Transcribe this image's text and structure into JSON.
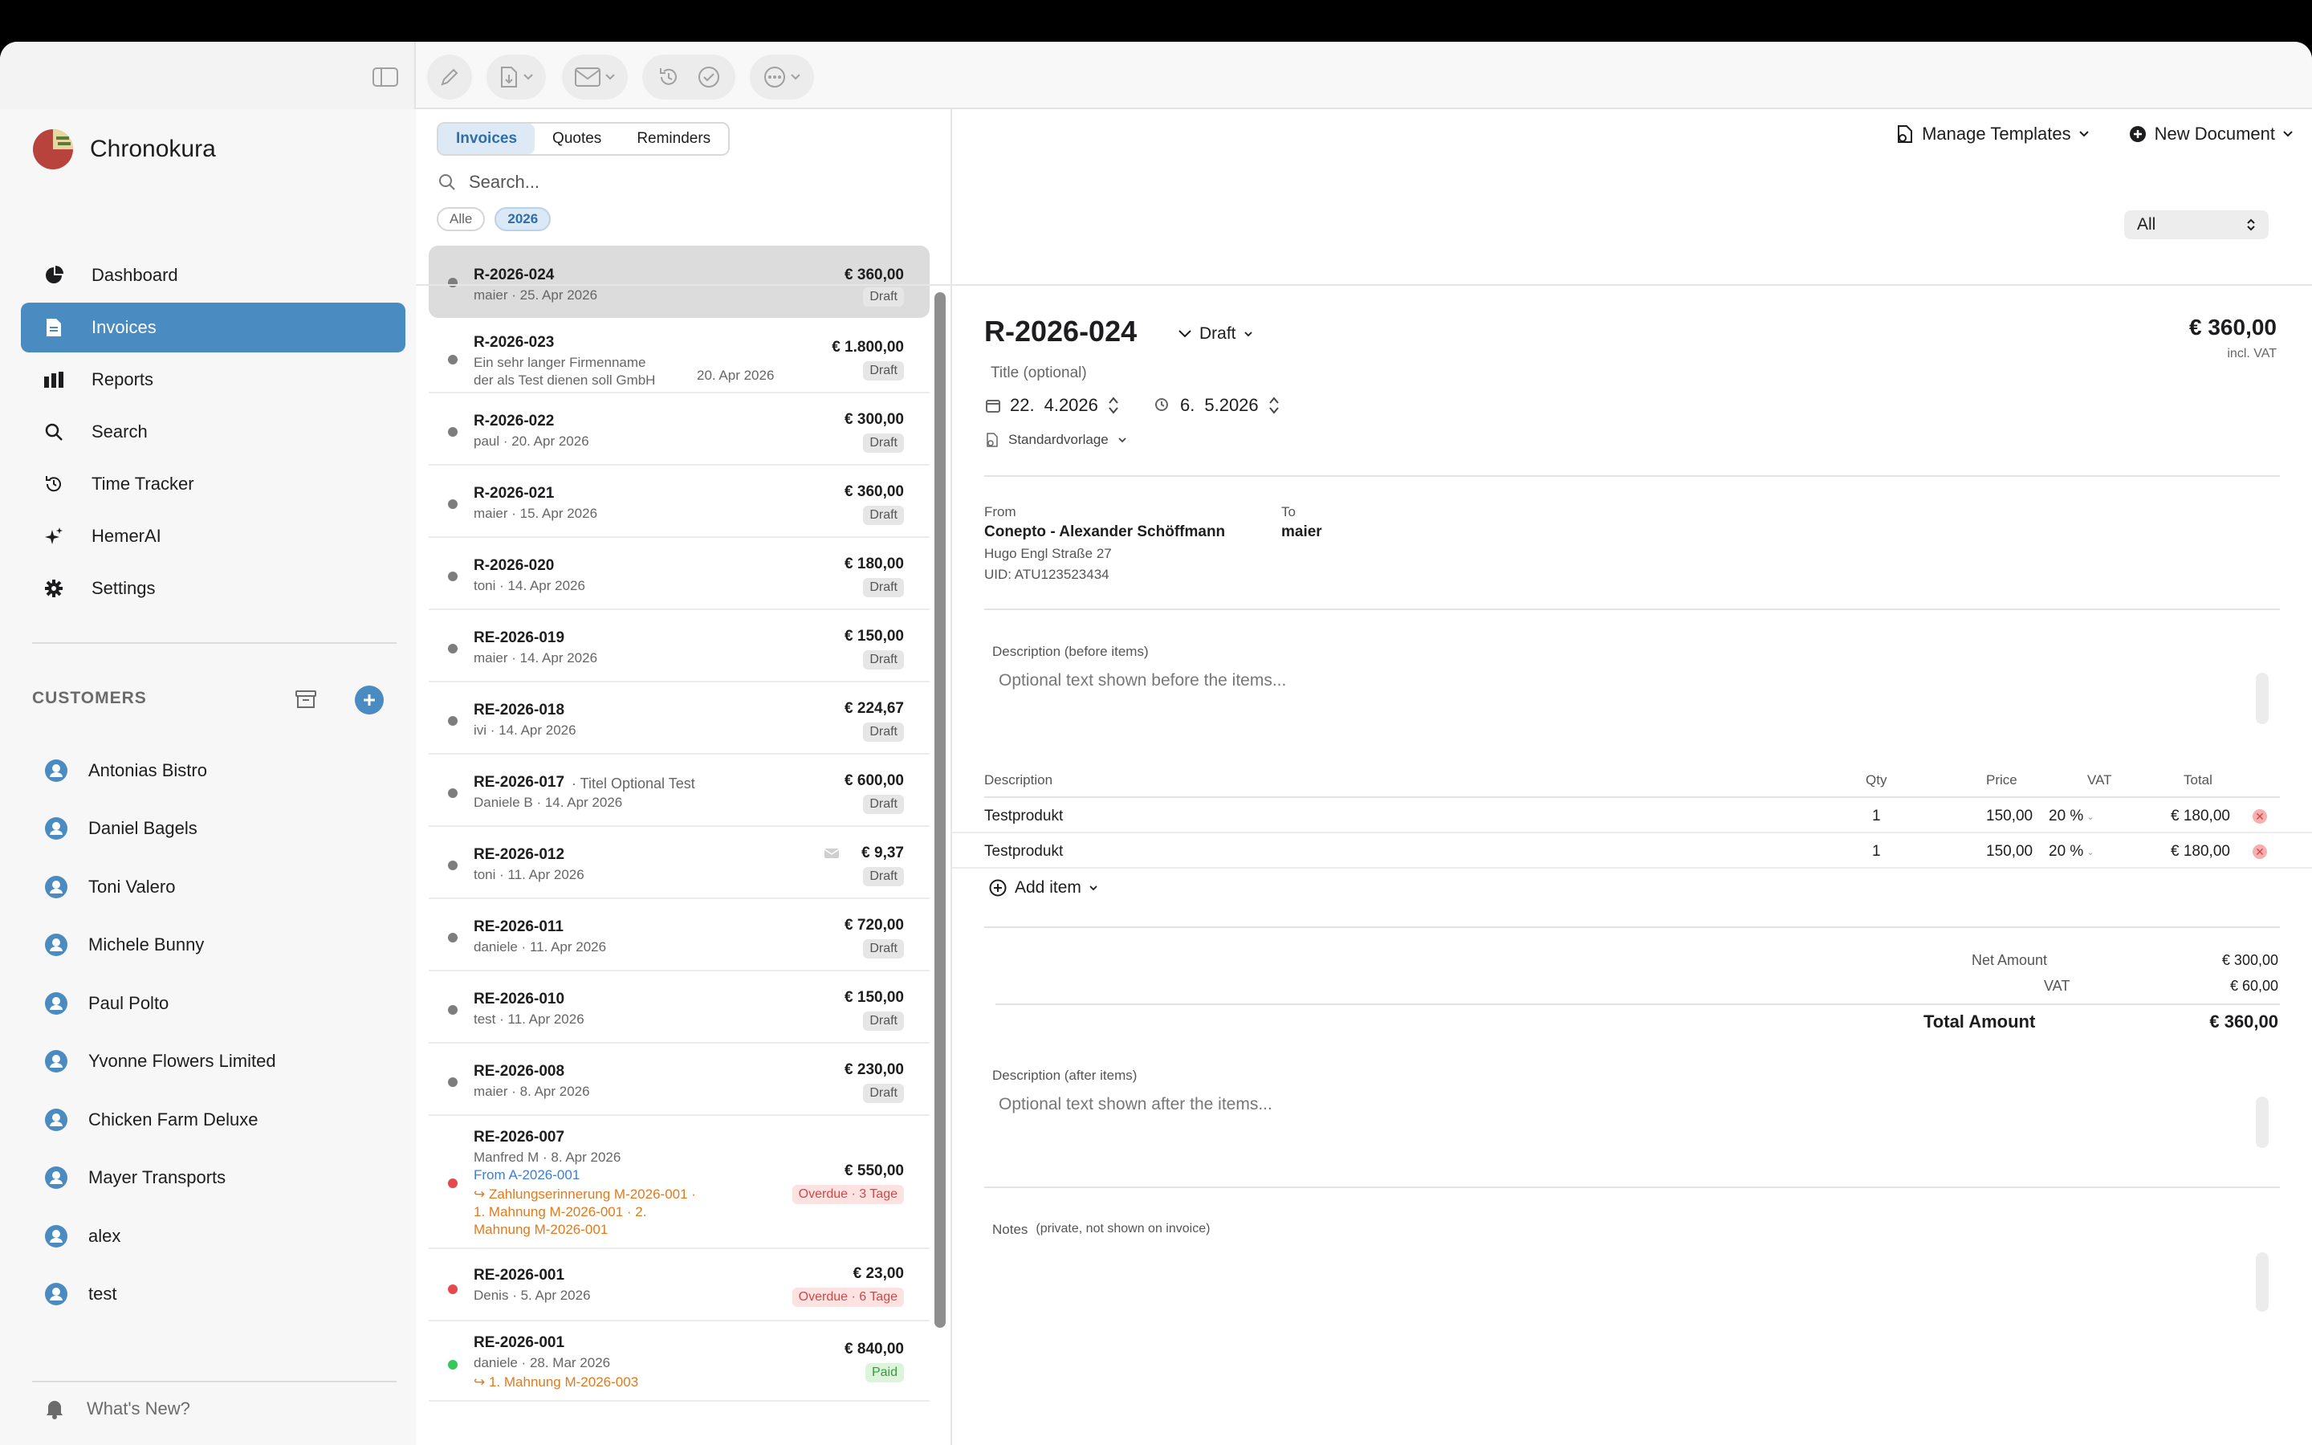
{
  "toolbar": {
    "icons": [
      "sidebar-toggle-icon",
      "pencil-icon",
      "export-icon",
      "mail-icon",
      "history-icon",
      "check-icon",
      "more-icon"
    ]
  },
  "sidebar": {
    "app_name": "Chronokura",
    "nav": [
      {
        "label": "Dashboard",
        "icon": "dashboard-icon"
      },
      {
        "label": "Invoices",
        "icon": "document-icon",
        "active": true
      },
      {
        "label": "Reports",
        "icon": "chart-icon"
      },
      {
        "label": "Search",
        "icon": "search-icon"
      },
      {
        "label": "Time Tracker",
        "icon": "clock-icon"
      },
      {
        "label": "HemerAI",
        "icon": "sparkle-icon"
      },
      {
        "label": "Settings",
        "icon": "gear-icon"
      }
    ],
    "customers_title": "CUSTOMERS",
    "customers": [
      "Antonias Bistro",
      "Daniel Bagels",
      "Toni Valero",
      "Michele Bunny",
      "Paul Polto",
      "Yvonne Flowers Limited",
      "Chicken Farm Deluxe",
      "Mayer Transports",
      "alex",
      "test"
    ],
    "whats_new": "What's New?"
  },
  "list_panel": {
    "tabs": [
      "Invoices",
      "Quotes",
      "Reminders"
    ],
    "active_tab": "Invoices",
    "search_placeholder": "Search...",
    "filters": [
      "Alle",
      "2026"
    ],
    "active_filter": "2026",
    "invoices": [
      {
        "number": "R-2026-024",
        "client": "maier",
        "date": "25. Apr 2026",
        "amount": "€ 360,00",
        "status": "Draft",
        "dot": "#7d7d7d"
      },
      {
        "number": "R-2026-023",
        "client_line1": "Ein sehr langer Firmenname",
        "client_line2": "der als Test dienen soll GmbH",
        "date": "20. Apr 2026",
        "amount": "€ 1.800,00",
        "status": "Draft",
        "dot": "#7d7d7d"
      },
      {
        "number": "R-2026-022",
        "client": "paul",
        "date": "20. Apr 2026",
        "amount": "€ 300,00",
        "status": "Draft",
        "dot": "#7d7d7d"
      },
      {
        "number": "R-2026-021",
        "client": "maier",
        "date": "15. Apr 2026",
        "amount": "€ 360,00",
        "status": "Draft",
        "dot": "#7d7d7d"
      },
      {
        "number": "R-2026-020",
        "client": "toni",
        "date": "14. Apr 2026",
        "amount": "€ 180,00",
        "status": "Draft",
        "dot": "#7d7d7d"
      },
      {
        "number": "RE-2026-019",
        "client": "maier",
        "date": "14. Apr 2026",
        "amount": "€ 150,00",
        "status": "Draft",
        "dot": "#7d7d7d"
      },
      {
        "number": "RE-2026-018",
        "client": "ivi",
        "date": "14. Apr 2026",
        "amount": "€ 224,67",
        "status": "Draft",
        "dot": "#7d7d7d"
      },
      {
        "number": "RE-2026-017",
        "title": "· Titel Optional Test",
        "client": "Daniele B",
        "date": "14. Apr 2026",
        "amount": "€ 600,00",
        "status": "Draft",
        "dot": "#7d7d7d"
      },
      {
        "number": "RE-2026-012",
        "client": "toni",
        "date": "11. Apr 2026",
        "amount": "€ 9,37",
        "status": "Draft",
        "dot": "#7d7d7d",
        "mail": true
      },
      {
        "number": "RE-2026-011",
        "client": "daniele",
        "date": "11. Apr 2026",
        "amount": "€ 720,00",
        "status": "Draft",
        "dot": "#7d7d7d"
      },
      {
        "number": "RE-2026-010",
        "client": "test",
        "date": "11. Apr 2026",
        "amount": "€ 150,00",
        "status": "Draft",
        "dot": "#7d7d7d"
      },
      {
        "number": "RE-2026-008",
        "client": "maier",
        "date": "8. Apr 2026",
        "amount": "€ 230,00",
        "status": "Draft",
        "dot": "#7d7d7d"
      },
      {
        "number": "RE-2026-007",
        "client": "Manfred M",
        "date": "8. Apr 2026",
        "from": "From A-2026-001",
        "reminder_lines": [
          "↪ Zahlungserinnerung M-2026-001  ·",
          "1. Mahnung M-2026-001  ·  2.",
          "Mahnung M-2026-001"
        ],
        "amount": "€ 550,00",
        "status": "Overdue · 3 Tage",
        "dot": "#e5484d"
      },
      {
        "number": "RE-2026-001",
        "client": "Denis",
        "date": "5. Apr 2026",
        "amount": "€ 23,00",
        "status": "Overdue · 6 Tage",
        "dot": "#e5484d"
      },
      {
        "number": "RE-2026-001",
        "client": "daniele",
        "date": "28. Mar 2026",
        "reminder_lines": [
          "↪ 1. Mahnung M-2026-003"
        ],
        "amount": "€ 840,00",
        "status": "Paid",
        "dot": "#34c759"
      }
    ]
  },
  "detail": {
    "manage_templates": "Manage Templates",
    "new_document": "New Document",
    "status_filter": "All",
    "number": "R-2026-024",
    "status": "Draft",
    "total_top": "€ 360,00",
    "incl_vat": "incl. VAT",
    "title_placeholder": "Title (optional)",
    "date_day": "22.",
    "date_rest": "4.2026",
    "due_day": "6.",
    "due_rest": "5.2026",
    "template": "Standardvorlage",
    "from_label": "From",
    "from_name": "Conepto - Alexander Schöffmann",
    "from_street": "Hugo Engl Straße 27",
    "from_uid": "UID: ATU123523434",
    "to_label": "To",
    "to_name": "maier",
    "desc_before_label": "Description (before items)",
    "desc_before_placeholder": "Optional text shown before the items...",
    "table_headers": {
      "description": "Description",
      "qty": "Qty",
      "price": "Price",
      "vat": "VAT",
      "total": "Total"
    },
    "items": [
      {
        "description": "Testprodukt",
        "qty": "1",
        "price": "150,00",
        "vat": "20 %",
        "total": "€ 180,00"
      },
      {
        "description": "Testprodukt",
        "qty": "1",
        "price": "150,00",
        "vat": "20 %",
        "total": "€ 180,00"
      }
    ],
    "add_item": "Add item",
    "net_label": "Net Amount",
    "net_value": "€ 300,00",
    "vat_label": "VAT",
    "vat_value": "€ 60,00",
    "total_label": "Total Amount",
    "total_value": "€ 360,00",
    "desc_after_label": "Description (after items)",
    "desc_after_placeholder": "Optional text shown after the items...",
    "notes_label": "Notes",
    "notes_hint": "(private, not shown on invoice)"
  }
}
